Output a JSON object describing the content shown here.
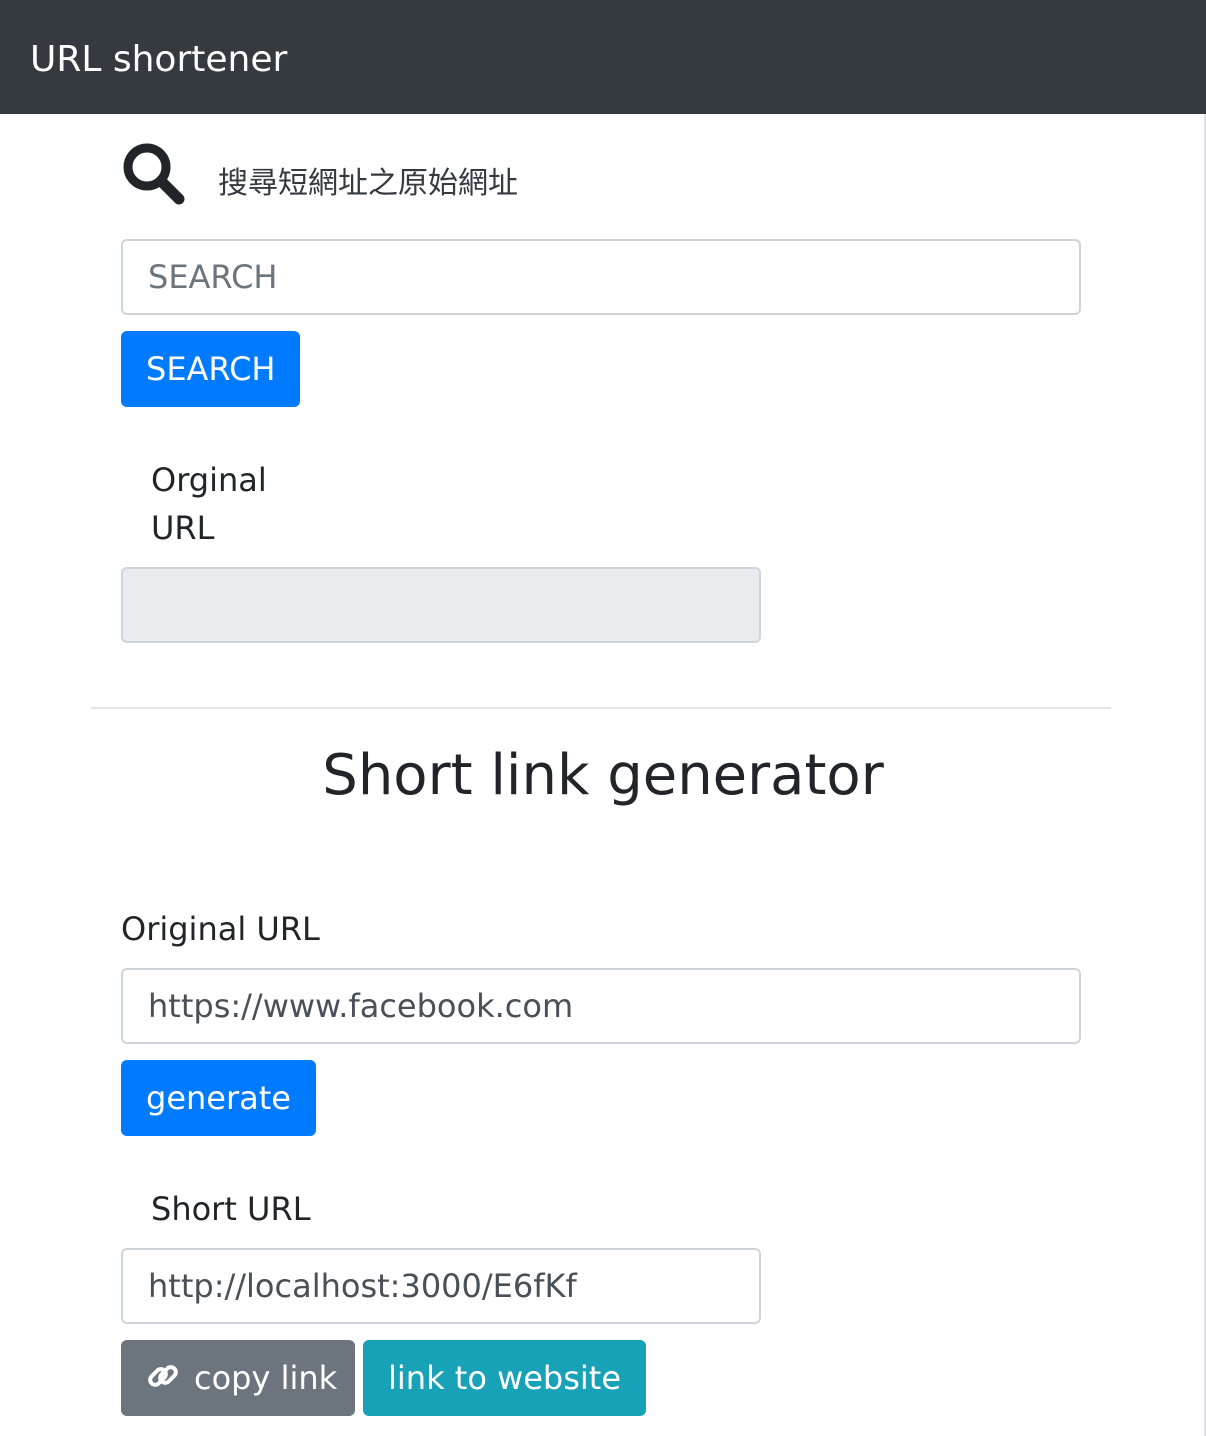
{
  "navbar": {
    "brand": "URL shortener"
  },
  "search_section": {
    "icon": "search-icon",
    "heading": "搜尋短網址之原始網址",
    "input_placeholder": "SEARCH",
    "input_value": "",
    "button_label": "SEARCH",
    "result_label_line1": "Orginal",
    "result_label_line2": "URL",
    "result_value": ""
  },
  "generator_section": {
    "title": "Short link generator",
    "original_url_label": "Original URL",
    "original_url_value": "https://www.facebook.com",
    "generate_label": "generate",
    "short_url_label": "Short URL",
    "short_url_value": "http://localhost:3000/E6fKf",
    "copy_icon": "link-icon",
    "copy_label": "copy link",
    "visit_label": "link to website"
  },
  "colors": {
    "navbar": "#343a40",
    "primary": "#007bff",
    "secondary": "#6c757d",
    "info": "#17a2b8",
    "readonly_bg": "#e9ecef"
  }
}
